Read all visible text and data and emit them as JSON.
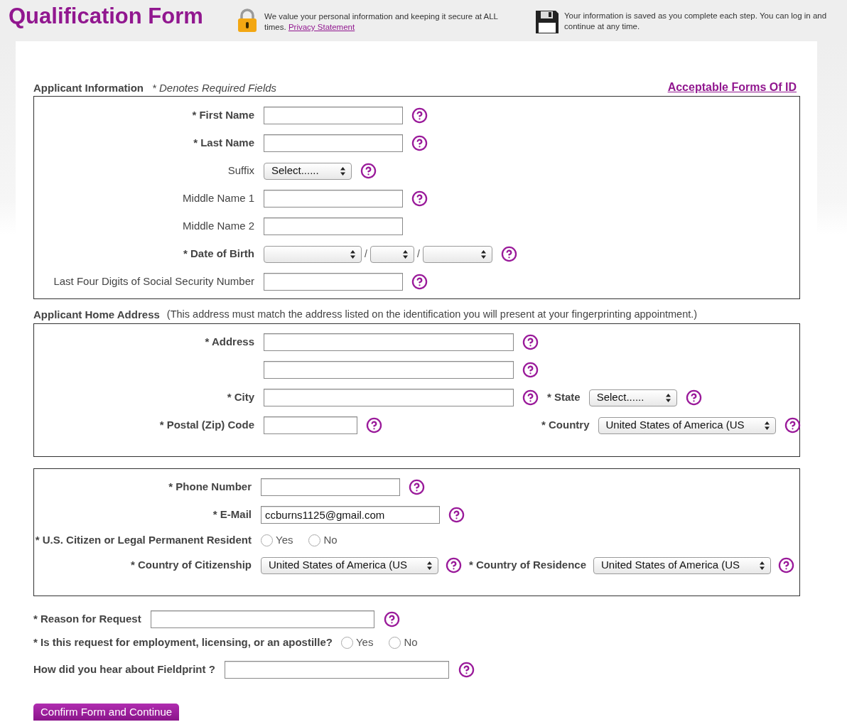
{
  "header": {
    "title": "Qualification Form",
    "privacy_notice": "We value your personal information and keeping it secure at ALL times.",
    "privacy_link": "Privacy Statement",
    "save_notice": "Your information is saved as you complete each step. You can log in and continue at any time."
  },
  "applicant_information": {
    "heading": "Applicant Information",
    "note": "* Denotes Required Fields",
    "id_link": "Acceptable Forms Of ID",
    "fields": [
      {
        "label": "* First Name",
        "required": true,
        "kind": "text",
        "help": true
      },
      {
        "label": "* Last Name",
        "required": true,
        "kind": "text",
        "help": true
      },
      {
        "label": "Suffix",
        "required": false,
        "kind": "select",
        "value": "Select......",
        "help": true
      },
      {
        "label": "Middle Name 1",
        "required": false,
        "kind": "text",
        "help": true
      },
      {
        "label": "Middle Name 2",
        "required": false,
        "kind": "text",
        "help": false
      },
      {
        "label": "* Date of Birth",
        "required": true,
        "kind": "date",
        "separators": [
          "/",
          "/"
        ],
        "help": true
      },
      {
        "label": "Last Four Digits of Social Security Number",
        "required": false,
        "kind": "text",
        "help": true
      }
    ]
  },
  "home_address": {
    "heading": "Applicant Home Address",
    "note": "(This address must match the address listed on the identification you will present at your fingerprinting appointment.)",
    "address": {
      "label": "* Address"
    },
    "city": {
      "label": "* City"
    },
    "state": {
      "label": "* State",
      "value": "Select......"
    },
    "postal_code": {
      "label": "* Postal (Zip) Code"
    },
    "country": {
      "label": "* Country",
      "value": "United States of America (US"
    }
  },
  "contact": {
    "phone": {
      "label": "* Phone Number"
    },
    "email": {
      "label": "* E-Mail",
      "value": "ccburns1125@gmail.com"
    },
    "citizen": {
      "label": "* U.S. Citizen or Legal Permanent Resident",
      "options": [
        {
          "label": "Yes",
          "selected": false
        },
        {
          "label": "No",
          "selected": false
        }
      ]
    },
    "citizenship": {
      "label": "* Country of Citizenship",
      "value": "United States of America (US"
    },
    "residence": {
      "label": "* Country of Residence",
      "value": "United States of America (US"
    }
  },
  "request": {
    "reason": {
      "label": "* Reason for Request"
    },
    "purpose": {
      "label": "* Is this request for employment, licensing, or an apostille?",
      "options": [
        {
          "label": "Yes",
          "selected": false
        },
        {
          "label": "No",
          "selected": false
        }
      ]
    },
    "referral": {
      "label": "How did you hear about Fieldprint ?"
    }
  },
  "submit_button": "Confirm Form and Continue"
}
